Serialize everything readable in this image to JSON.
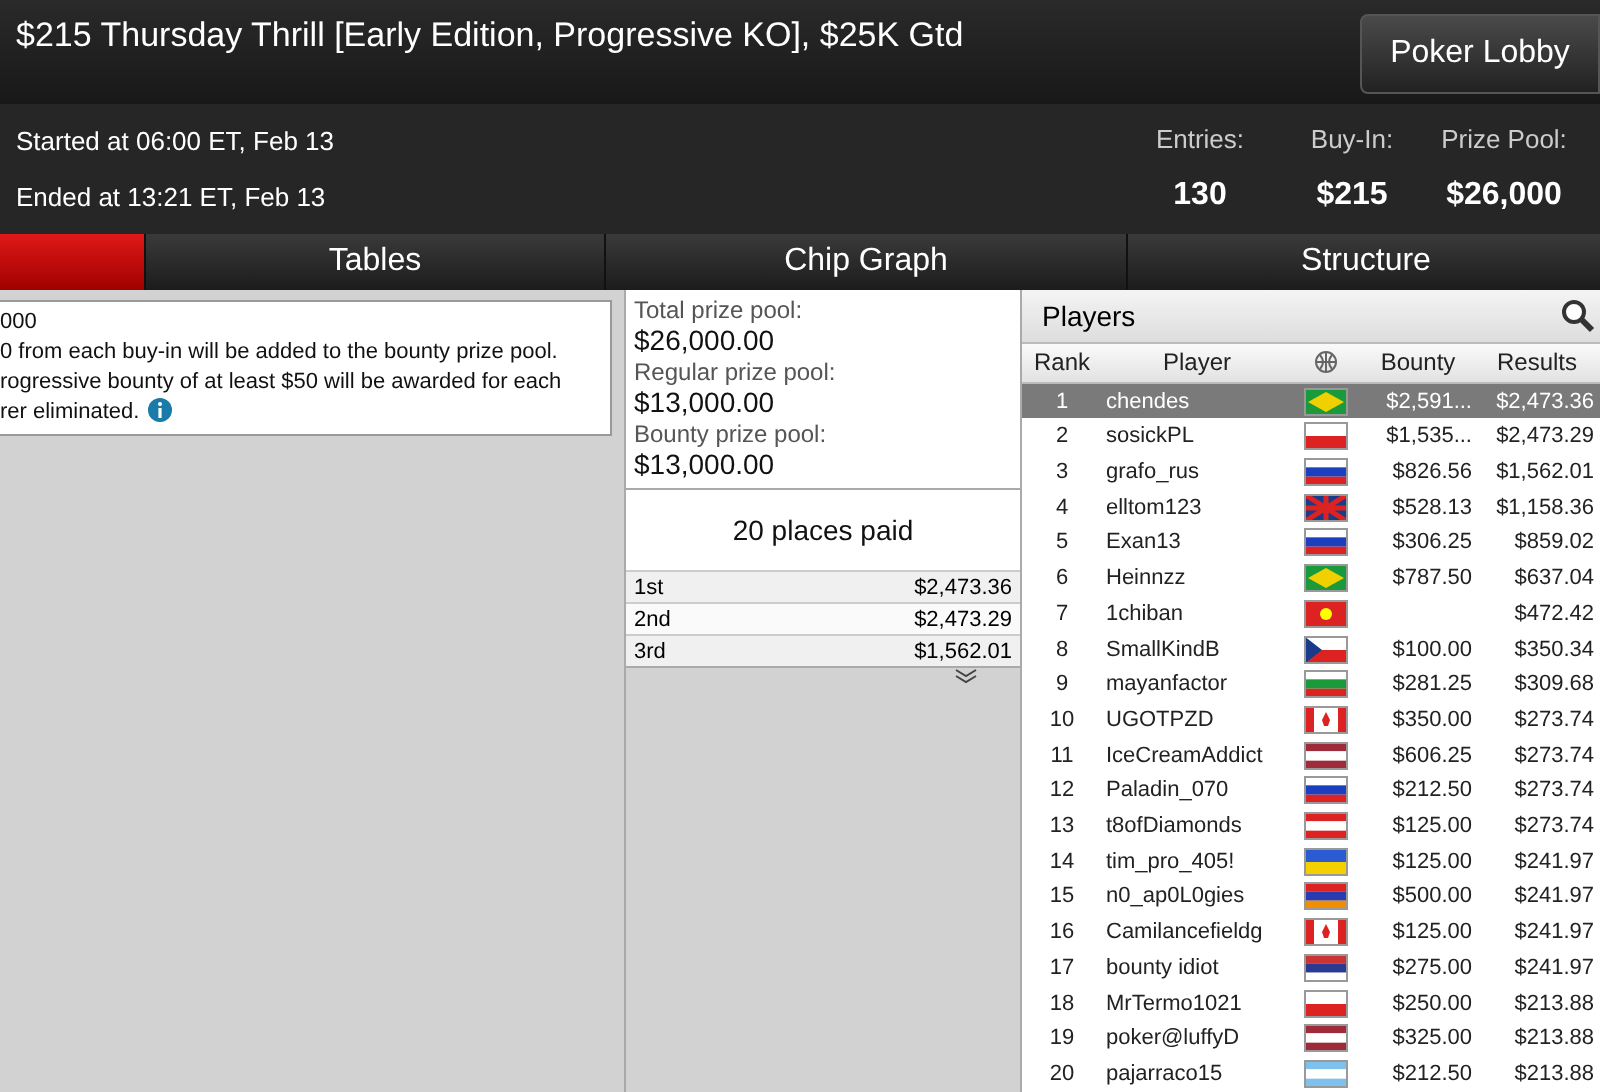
{
  "window": {
    "title": "$215 Thursday Thrill [Early Edition, Progressive KO], $25K Gtd"
  },
  "lobby_button": "Poker Lobby",
  "started": "Started at 06:00 ET, Feb 13",
  "ended": "Ended at 13:21 ET, Feb 13",
  "stats": [
    {
      "label": "Entries:",
      "value": "130"
    },
    {
      "label": "Buy-In:",
      "value": "$215"
    },
    {
      "label": "Prize Pool:",
      "value": "$26,000"
    }
  ],
  "tabs": [
    {
      "selected": true
    },
    {
      "label": "Tables",
      "selected": false
    },
    {
      "label": "Chip Graph",
      "selected": false
    },
    {
      "label": "Structure",
      "selected": false
    }
  ],
  "info_lines": [
    "000",
    "0 from each buy-in will be added to the bounty prize pool.",
    "rogressive bounty of at least $50 will be awarded for each",
    "rer eliminated."
  ],
  "pools": [
    {
      "label": "Total prize pool:",
      "value": "$26,000.00"
    },
    {
      "label": "Regular prize pool:",
      "value": "$13,000.00"
    },
    {
      "label": "Bounty prize pool:",
      "value": "$13,000.00"
    }
  ],
  "places_paid": "20 places paid",
  "payouts": [
    {
      "place": "1st",
      "amount": "$2,473.36"
    },
    {
      "place": "2nd",
      "amount": "$2,473.29"
    },
    {
      "place": "3rd",
      "amount": "$1,562.01"
    }
  ],
  "players": {
    "title": "Players",
    "columns": [
      "Rank",
      "Player",
      "Bounty",
      "Results"
    ],
    "rows": [
      {
        "rank": "1",
        "player": "chendes",
        "kind": "br",
        "bounty": "$2,591...",
        "result": "$2,473.36",
        "selected": true
      },
      {
        "rank": "2",
        "player": "sosickPL",
        "kind": "pl",
        "bounty": "$1,535...",
        "result": "$2,473.29",
        "selected": false
      },
      {
        "rank": "3",
        "player": "grafo_rus",
        "kind": "ru",
        "bounty": "$826.56",
        "result": "$1,562.01",
        "selected": false
      },
      {
        "rank": "4",
        "player": "elltom123",
        "kind": "gb",
        "bounty": "$528.13",
        "result": "$1,158.36",
        "selected": false
      },
      {
        "rank": "5",
        "player": "Exan13",
        "kind": "ru",
        "bounty": "$306.25",
        "result": "$859.02",
        "selected": false
      },
      {
        "rank": "6",
        "player": "Heinnzz",
        "kind": "br",
        "bounty": "$787.50",
        "result": "$637.04",
        "selected": false
      },
      {
        "rank": "7",
        "player": "1chiban",
        "kind": "vn",
        "result": "$472.42",
        "selected": false
      },
      {
        "rank": "8",
        "player": "SmallKindB",
        "kind": "cz",
        "bounty": "$100.00",
        "result": "$350.34",
        "selected": false
      },
      {
        "rank": "9",
        "player": "mayanfactor",
        "kind": "bg",
        "bounty": "$281.25",
        "result": "$309.68",
        "selected": false
      },
      {
        "rank": "10",
        "player": "UGOTPZD",
        "kind": "ca",
        "bounty": "$350.00",
        "result": "$273.74",
        "selected": false
      },
      {
        "rank": "11",
        "player": "IceCreamAddict",
        "kind": "lv",
        "bounty": "$606.25",
        "result": "$273.74",
        "selected": false
      },
      {
        "rank": "12",
        "player": "Paladin_070",
        "kind": "ru",
        "bounty": "$212.50",
        "result": "$273.74",
        "selected": false
      },
      {
        "rank": "13",
        "player": "t8ofDiamonds",
        "kind": "at",
        "bounty": "$125.00",
        "result": "$273.74",
        "selected": false
      },
      {
        "rank": "14",
        "player": "tim_pro_405!",
        "kind": "ua",
        "bounty": "$125.00",
        "result": "$241.97",
        "selected": false
      },
      {
        "rank": "15",
        "player": "n0_ap0L0gies",
        "kind": "am",
        "bounty": "$500.00",
        "result": "$241.97",
        "selected": false
      },
      {
        "rank": "16",
        "player": "Camilancefieldg",
        "kind": "ca",
        "bounty": "$125.00",
        "result": "$241.97",
        "selected": false
      },
      {
        "rank": "17",
        "player": "bounty idiot",
        "kind": "rs",
        "bounty": "$275.00",
        "result": "$241.97",
        "selected": false
      },
      {
        "rank": "18",
        "player": "MrTermo1021",
        "kind": "pl",
        "bounty": "$250.00",
        "result": "$213.88",
        "selected": false
      },
      {
        "rank": "19",
        "player": "poker@luffyD",
        "kind": "lv",
        "bounty": "$325.00",
        "result": "$213.88",
        "selected": false
      },
      {
        "rank": "20",
        "player": "pajarraco15",
        "kind": "ar",
        "bounty": "$212.50",
        "result": "$213.88",
        "selected": false
      }
    ]
  }
}
